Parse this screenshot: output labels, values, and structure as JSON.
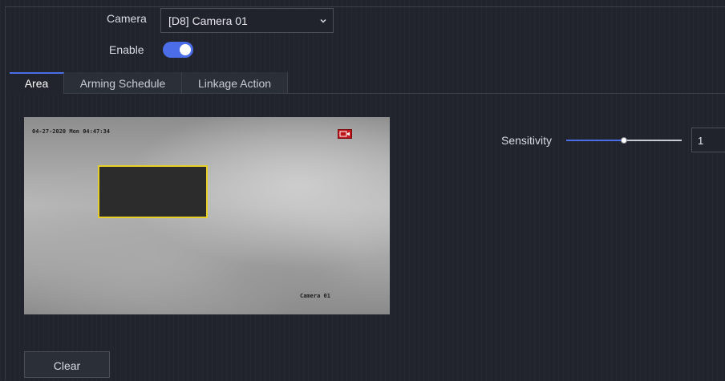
{
  "camera": {
    "label": "Camera",
    "value": "[D8] Camera 01"
  },
  "enable": {
    "label": "Enable",
    "on": true,
    "color": "#4b6ee8"
  },
  "tabs": [
    {
      "label": "Area",
      "active": true
    },
    {
      "label": "Arming Schedule",
      "active": false
    },
    {
      "label": "Linkage Action",
      "active": false
    }
  ],
  "video": {
    "timestamp": "04-27-2020 Mon 04:47:34",
    "camera_name": "Camera 01"
  },
  "sensitivity": {
    "label": "Sensitivity",
    "value": "1",
    "level_fraction": 0.5,
    "color": "#4b6ee8"
  },
  "clear_label": "Clear",
  "icons": {
    "dropdown": "chevron-down-icon",
    "recording": "recording-icon"
  }
}
